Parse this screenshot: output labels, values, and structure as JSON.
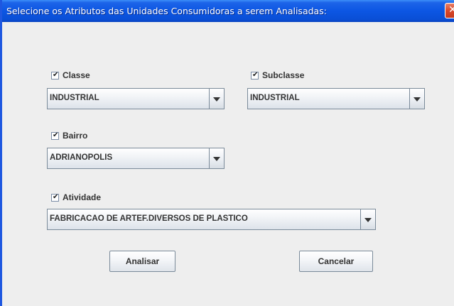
{
  "window": {
    "title": "Selecione os Atributos das Unidades Consumidoras a serem Analisadas:",
    "close_glyph": "✕"
  },
  "colors": {
    "titlebar": "#0c56e3",
    "close_button": "#d9482a",
    "background": "#eeeeee"
  },
  "fields": {
    "classe": {
      "label": "Classe",
      "checked": true,
      "value": "INDUSTRIAL"
    },
    "subclasse": {
      "label": "Subclasse",
      "checked": true,
      "value": "INDUSTRIAL"
    },
    "bairro": {
      "label": "Bairro",
      "checked": true,
      "value": "ADRIANOPOLIS"
    },
    "atividade": {
      "label": "Atividade",
      "checked": true,
      "value": "FABRICACAO DE ARTEF.DIVERSOS DE PLASTICO"
    }
  },
  "buttons": {
    "analisar": "Analisar",
    "cancelar": "Cancelar"
  },
  "icons": {
    "check": "✔",
    "dropdown": "triangle-down"
  }
}
